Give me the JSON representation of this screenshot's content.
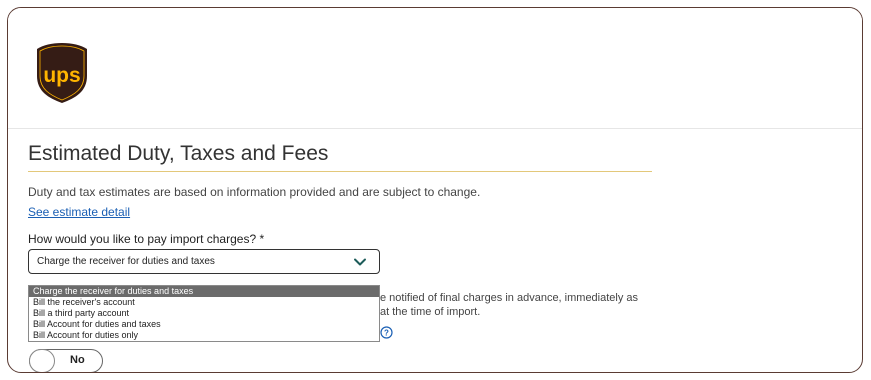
{
  "brand": {
    "logo_text": "ups",
    "brown": "#351c15",
    "gold": "#ffb500"
  },
  "section": {
    "title": "Estimated Duty, Taxes and Fees",
    "description": "Duty and tax estimates are based on information provided and are subject to change.",
    "estimate_link": "See estimate detail",
    "question": "How would you like to pay import charges? *"
  },
  "select": {
    "value": "Charge the receiver for duties and taxes",
    "options": [
      "Charge the receiver for duties and taxes",
      "Bill the receiver's account",
      "Bill a third party account",
      "Bill Account for duties and taxes",
      "Bill Account for duties only"
    ],
    "selected_index": 0
  },
  "notice": {
    "line1": "e notified of final charges in advance, immediately as",
    "line2": "at the time of import."
  },
  "toggle": {
    "label": "No"
  },
  "icons": {
    "chevron": "chevron-down-icon",
    "help": "help-circle-icon",
    "accent": "#1d5c5a",
    "help_color": "#1a5fb4"
  }
}
